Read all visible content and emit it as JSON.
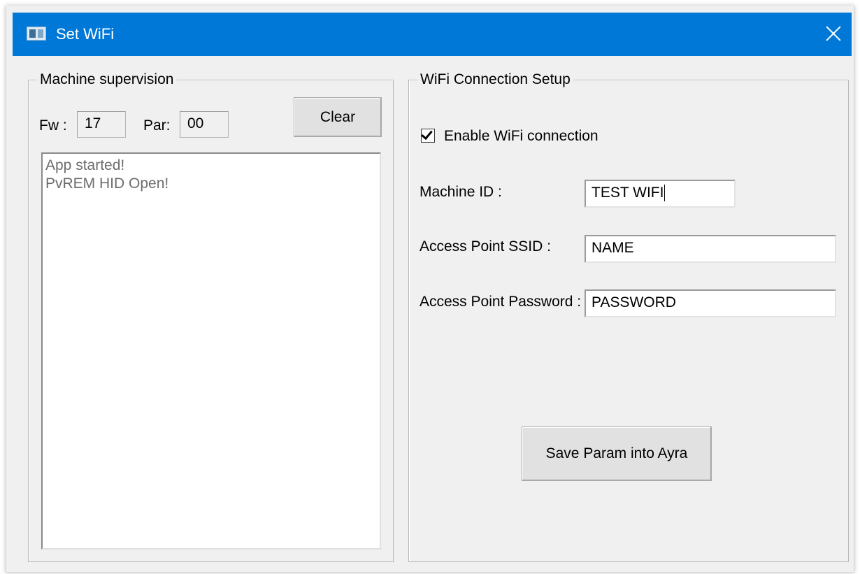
{
  "window": {
    "title": "Set WiFi",
    "title_bar_color": "#0078d7"
  },
  "icons": {
    "app": "app-window-icon",
    "close": "close-icon",
    "checkbox": "checkmark-icon"
  },
  "supervision": {
    "group_title": "Machine supervision",
    "fw_label": "Fw :",
    "fw_value": "17",
    "par_label": "Par:",
    "par_value": "00",
    "clear_label": "Clear",
    "log_lines": [
      "App started!",
      "PvREM HID Open!"
    ]
  },
  "wifi": {
    "group_title": "WiFi Connection Setup",
    "enable_label": "Enable WiFi connection",
    "enable_checked": true,
    "machine_id_label": "Machine ID :",
    "machine_id_value": "TEST WIFI",
    "ssid_label": "Access Point SSID :",
    "ssid_value": "NAME",
    "password_label": "Access Point Password :",
    "password_value": "PASSWORD",
    "save_label": "Save Param into Ayra"
  }
}
